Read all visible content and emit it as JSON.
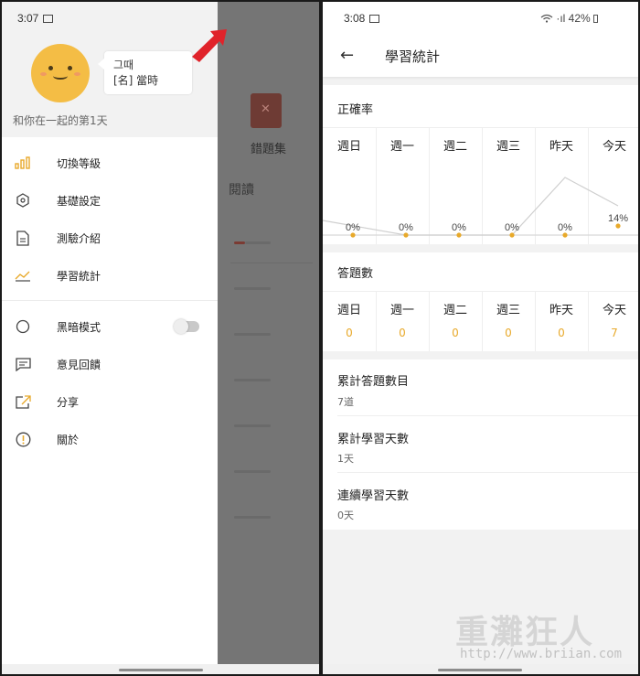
{
  "left": {
    "status": {
      "time": "3:07",
      "right": "·ıl 42%"
    },
    "bubble_line1": "그때",
    "bubble_line2": "[名] 當時",
    "together": "和你在一起的第1天",
    "menu": [
      {
        "label": "切換等級",
        "icon": "bar-chart-icon"
      },
      {
        "label": "基礎設定",
        "icon": "hexagon-settings-icon"
      },
      {
        "label": "測驗介紹",
        "icon": "document-icon"
      },
      {
        "label": "學習統計",
        "icon": "trend-icon"
      },
      {
        "label": "黑暗模式",
        "icon": "moon-icon"
      },
      {
        "label": "意見回饋",
        "icon": "feedback-icon"
      },
      {
        "label": "分享",
        "icon": "share-icon"
      },
      {
        "label": "關於",
        "icon": "info-icon"
      }
    ],
    "dark_mode_on": false,
    "behind": {
      "wrong_book": "錯題集",
      "reading": "閱讀"
    },
    "accent": "#f4bd45"
  },
  "right": {
    "status": {
      "time": "3:08",
      "right": "·ıl 42%"
    },
    "title": "學習統計",
    "accuracy_title": "正確率",
    "days": [
      "週日",
      "週一",
      "週二",
      "週三",
      "昨天",
      "今天"
    ],
    "accuracy_labels": [
      "0%",
      "0%",
      "0%",
      "0%",
      "0%",
      "14%"
    ],
    "answers_title": "答題數",
    "answer_counts": [
      "0",
      "0",
      "0",
      "0",
      "0",
      "7"
    ],
    "stats": [
      {
        "label": "累計答題數目",
        "value": "7道"
      },
      {
        "label": "累計學習天數",
        "value": "1天"
      },
      {
        "label": "連續學習天數",
        "value": "0天"
      }
    ],
    "accent": "#e8a92a",
    "watermark": "重灘狂人",
    "watermark_url": "http://www.briian.com"
  },
  "chart_data": {
    "type": "line",
    "categories": [
      "週日",
      "週一",
      "週二",
      "週三",
      "昨天",
      "今天"
    ],
    "series": [
      {
        "name": "",
        "values": [
          0,
          0,
          0,
          0,
          0,
          14
        ]
      }
    ],
    "title": "正確率",
    "ylabel": "",
    "xlabel": "",
    "ylim": [
      0,
      100
    ]
  }
}
